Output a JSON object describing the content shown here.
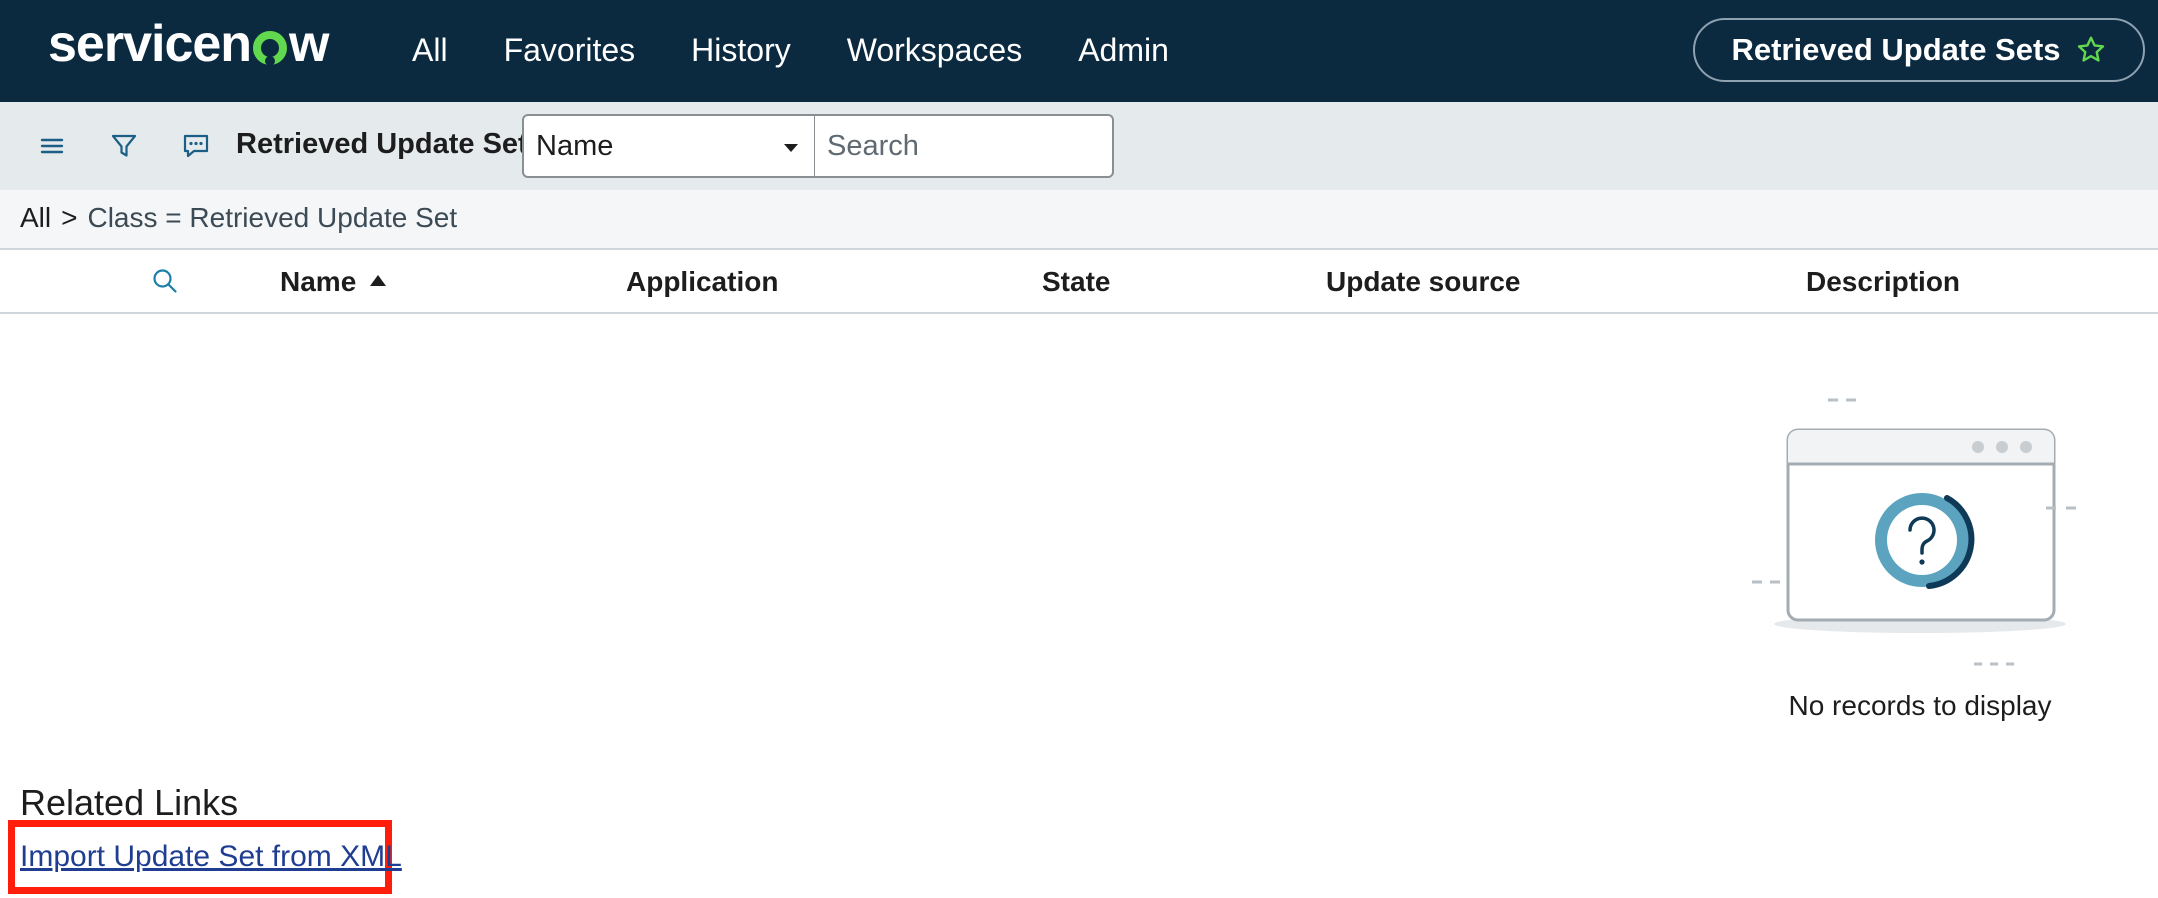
{
  "brand": {
    "logo_text_left": "servicen",
    "logo_text_right": "w",
    "accent_color": "#62d84e",
    "nav_bg": "#0b2a40"
  },
  "nav": {
    "items": [
      {
        "label": "All"
      },
      {
        "label": "Favorites"
      },
      {
        "label": "History"
      },
      {
        "label": "Workspaces"
      },
      {
        "label": "Admin"
      }
    ],
    "context_pill": {
      "label": "Retrieved Update Sets",
      "icon": "star-outline-icon"
    }
  },
  "toolbar": {
    "icons": [
      "hamburger-menu-icon",
      "filter-icon",
      "comment-icon"
    ],
    "title": "Retrieved Update Sets",
    "field_select": {
      "value": "Name"
    },
    "search": {
      "placeholder": "Search",
      "value": ""
    }
  },
  "breadcrumb": {
    "root": "All",
    "separator": ">",
    "condition": "Class = Retrieved Update Set"
  },
  "table": {
    "columns": [
      {
        "label": "Name",
        "sorted": "ascending"
      },
      {
        "label": "Application"
      },
      {
        "label": "State"
      },
      {
        "label": "Update source"
      },
      {
        "label": "Description"
      }
    ],
    "rows": [],
    "empty_message": "No records to display"
  },
  "related_links": {
    "title": "Related Links",
    "links": [
      {
        "label": "Import Update Set from XML",
        "highlighted": true
      }
    ]
  }
}
